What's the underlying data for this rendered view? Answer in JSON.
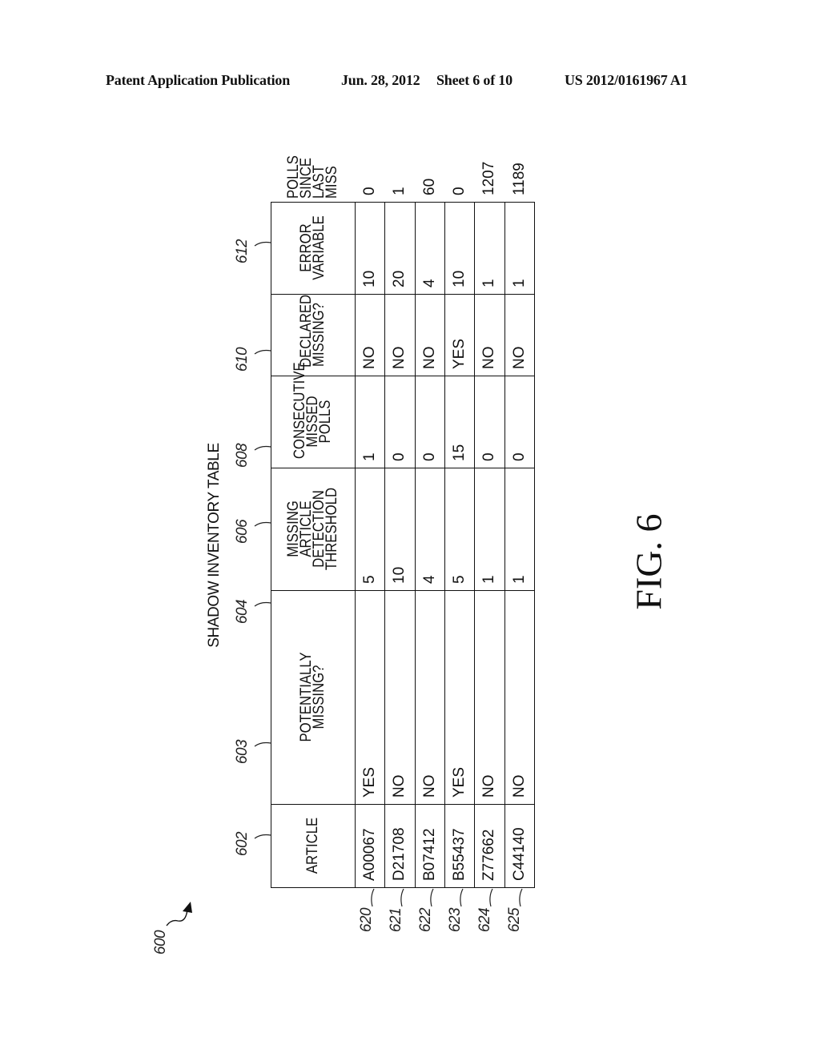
{
  "header": {
    "publication": "Patent Application Publication",
    "date": "Jun. 28, 2012",
    "sheet": "Sheet 6 of 10",
    "patent_number": "US 2012/0161967 A1"
  },
  "figure": {
    "caption": "SHADOW INVENTORY TABLE",
    "label": "FIG. 6",
    "ref_table": "600",
    "columns": [
      {
        "ref": "602",
        "lines": [
          "ARTICLE"
        ]
      },
      {
        "ref": "603",
        "lines": [
          "POTENTIALLY",
          "MISSING?"
        ]
      },
      {
        "ref": "604",
        "lines": [
          "MISSING",
          "ARTICLE",
          "DETECTION",
          "THRESHOLD"
        ]
      },
      {
        "ref": "606",
        "lines": [
          "CONSECUTIVE",
          "MISSED",
          "POLLS"
        ]
      },
      {
        "ref": "608",
        "lines": [
          "DECLARED",
          "MISSING?"
        ]
      },
      {
        "ref": "610",
        "lines": [
          "ERROR",
          "VARIABLE"
        ]
      },
      {
        "ref": "612",
        "lines": [
          "POLLS",
          "SINCE",
          "LAST MISS"
        ]
      }
    ],
    "rows": [
      {
        "ref": "620",
        "cells": [
          "A00067",
          "YES",
          "5",
          "1",
          "NO",
          "10",
          "0"
        ]
      },
      {
        "ref": "621",
        "cells": [
          "D21708",
          "NO",
          "10",
          "0",
          "NO",
          "20",
          "1"
        ]
      },
      {
        "ref": "622",
        "cells": [
          "B07412",
          "NO",
          "4",
          "0",
          "NO",
          "4",
          "60"
        ]
      },
      {
        "ref": "623",
        "cells": [
          "B55437",
          "YES",
          "5",
          "15",
          "YES",
          "10",
          "0"
        ]
      },
      {
        "ref": "624",
        "cells": [
          "Z77662",
          "NO",
          "1",
          "0",
          "NO",
          "1",
          "1207"
        ]
      },
      {
        "ref": "625",
        "cells": [
          "C44140",
          "NO",
          "1",
          "0",
          "NO",
          "1",
          "1189"
        ]
      }
    ]
  }
}
